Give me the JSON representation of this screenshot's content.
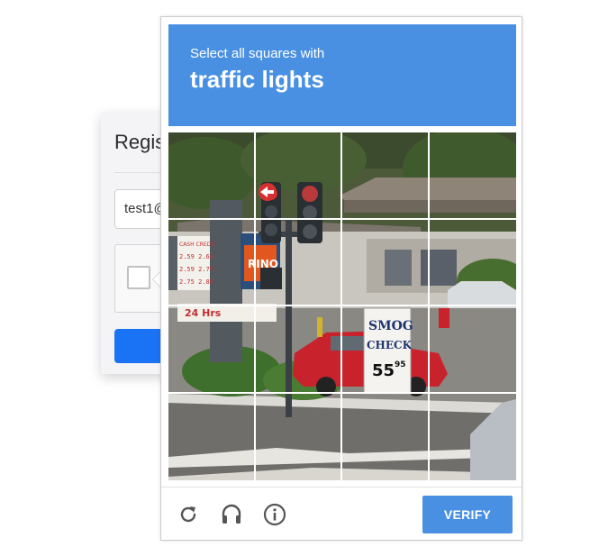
{
  "registration": {
    "title": "Regis",
    "email_value": "test1@"
  },
  "challenge": {
    "prompt_prefix": "Select all squares with",
    "prompt_keyword": "traffic lights",
    "tiles": [
      {
        "row": 1,
        "col": 1
      },
      {
        "row": 1,
        "col": 2
      },
      {
        "row": 1,
        "col": 3
      },
      {
        "row": 1,
        "col": 4
      },
      {
        "row": 2,
        "col": 1
      },
      {
        "row": 2,
        "col": 2
      },
      {
        "row": 2,
        "col": 3
      },
      {
        "row": 2,
        "col": 4
      },
      {
        "row": 3,
        "col": 1
      },
      {
        "row": 3,
        "col": 2
      },
      {
        "row": 3,
        "col": 3
      },
      {
        "row": 3,
        "col": 4
      },
      {
        "row": 4,
        "col": 1
      },
      {
        "row": 4,
        "col": 2
      },
      {
        "row": 4,
        "col": 3
      },
      {
        "row": 4,
        "col": 4
      }
    ],
    "scene_signs": {
      "price_board_header": "CASH CREDIT",
      "price_rows": [
        "2.59 2.63",
        "2.59 2.79",
        "2.75 2.85"
      ],
      "brand": "RINO",
      "smog_line1": "SMOG",
      "smog_line2": "CHECK",
      "smog_price": "55",
      "smog_cents": "95",
      "bottom_sign": "24 Hrs"
    },
    "footer": {
      "reload_icon": "reload-icon",
      "audio_icon": "headphones-icon",
      "info_icon": "info-icon",
      "verify_label": "VERIFY"
    }
  },
  "colors": {
    "prompt_bg": "#4a90e2",
    "verify_bg": "#4a90e2",
    "register_button": "#1a73f5"
  }
}
